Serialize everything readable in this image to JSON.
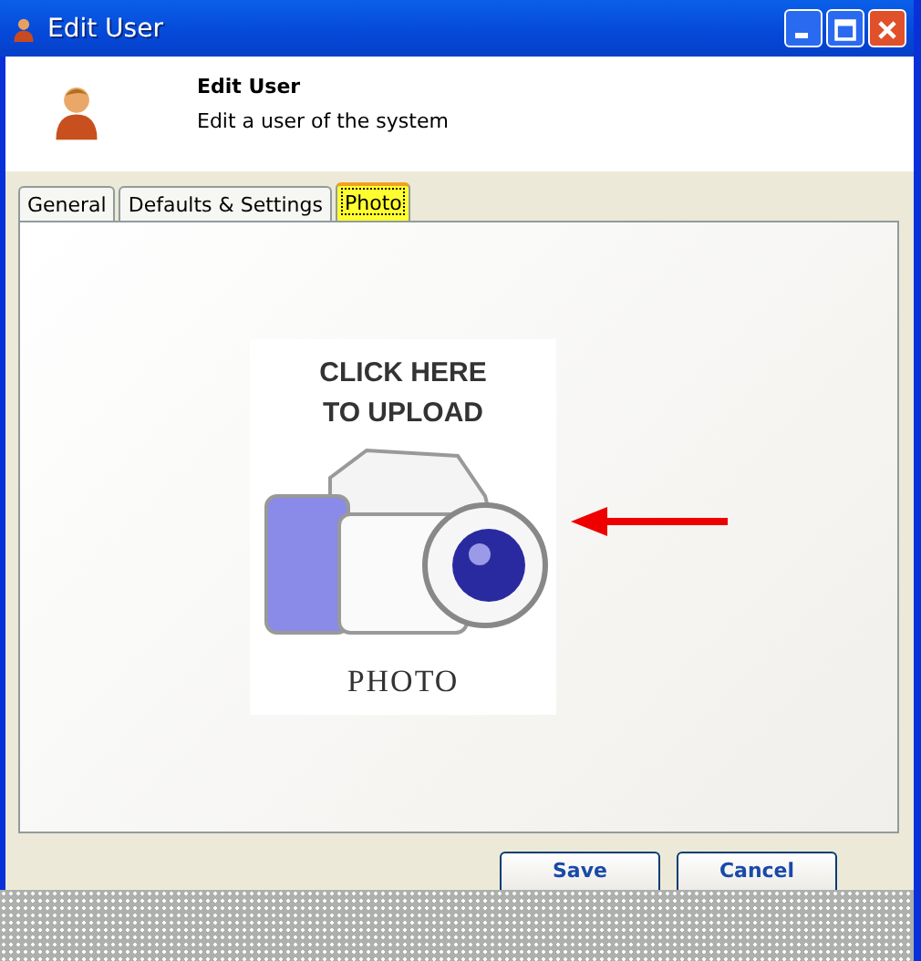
{
  "window": {
    "title": "Edit User"
  },
  "header": {
    "title": "Edit User",
    "subtitle": "Edit a user of the system"
  },
  "tabs": [
    {
      "label": "General",
      "selected": false
    },
    {
      "label": "Defaults & Settings",
      "selected": false
    },
    {
      "label": "Photo",
      "selected": true
    }
  ],
  "upload": {
    "line_1": "CLICK HERE",
    "line_2": "TO UPLOAD",
    "caption": "PHOTO"
  },
  "buttons": [
    "Save",
    "Cancel"
  ]
}
